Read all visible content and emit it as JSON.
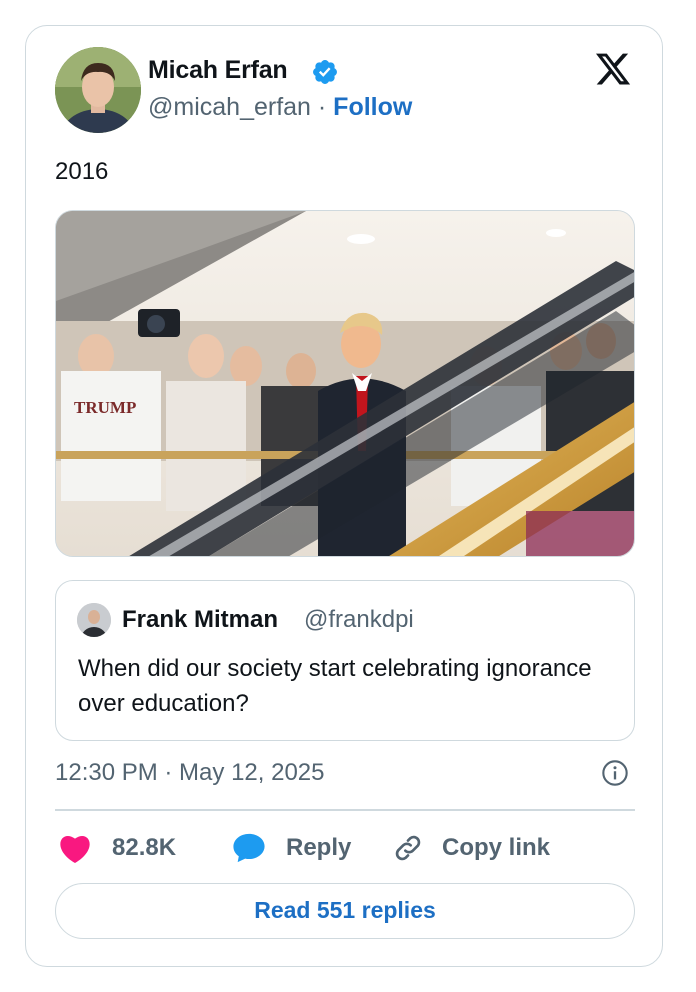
{
  "author": {
    "name": "Micah Erfan",
    "handle": "@micah_erfan",
    "separator": " · ",
    "follow_label": "Follow"
  },
  "post": {
    "text": "2016",
    "timestamp": "12:30 PM · May 12, 2025"
  },
  "quoted_post": {
    "name": "Frank Mitman",
    "handle": "@frankdpi",
    "text": "When did our society start celebrating ignorance over education?"
  },
  "photo": {
    "shirt_text": "TRUMP"
  },
  "actions": {
    "likes": "82.8K",
    "reply_label": "Reply",
    "copy_link_label": "Copy link"
  },
  "read_replies_label": "Read 551 replies",
  "icons": {
    "verified": "verified-badge-icon",
    "brand": "x-logo-icon",
    "info": "info-icon",
    "like": "heart-icon",
    "reply": "speech-bubble-icon",
    "copy": "link-icon"
  },
  "colors": {
    "accent": "#1d6fc4",
    "verified": "#1d9bf0",
    "like": "#f91880",
    "muted": "#536471",
    "border": "#cfd9de"
  }
}
